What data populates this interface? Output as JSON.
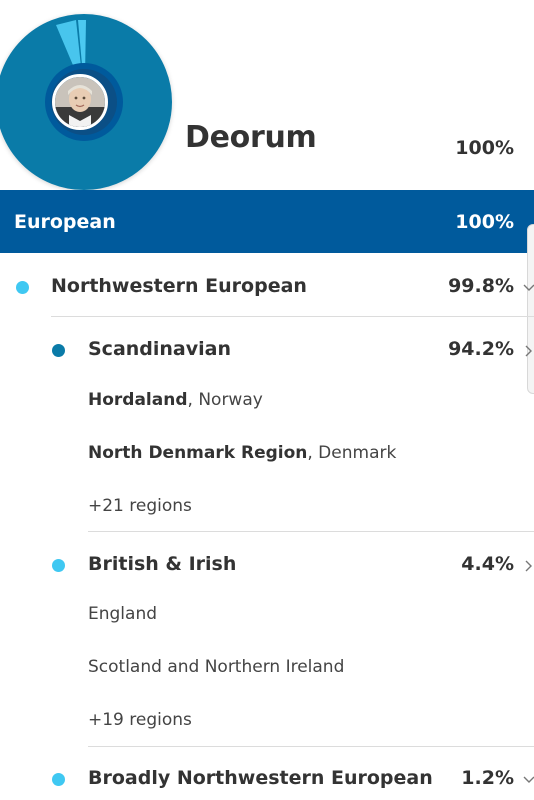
{
  "profile": {
    "name": "Deorum",
    "total_percent": "100%",
    "avatar_icon": "profile-photo"
  },
  "colors": {
    "brand_blue": "#005a9c",
    "donut_main": "#0a7ba8",
    "donut_light": "#4cc9f0",
    "dot_light": "#3fc8f2",
    "dot_dark": "#0a7ba8"
  },
  "region": {
    "label": "European",
    "percent": "100%"
  },
  "groups": [
    {
      "label": "Northwestern European",
      "percent": "99.8%",
      "dot_color": "#3fc8f2",
      "chevron_icon": "chevron-down-icon"
    }
  ],
  "subgroups": [
    {
      "label": "Scandinavian",
      "percent": "94.2%",
      "dot_color": "#0a7ba8",
      "chevron_icon": "chevron-right-icon",
      "items": [
        {
          "primary": "Hordaland",
          "secondary": ", Norway"
        },
        {
          "primary": "North Denmark Region",
          "secondary": ", Denmark"
        },
        {
          "primary": "",
          "secondary": "+21 regions"
        }
      ]
    },
    {
      "label": "British & Irish",
      "percent": "4.4%",
      "dot_color": "#3fc8f2",
      "chevron_icon": "chevron-right-icon",
      "items": [
        {
          "primary": "",
          "secondary": "England"
        },
        {
          "primary": "",
          "secondary": "Scotland and Northern Ireland"
        },
        {
          "primary": "",
          "secondary": "+19 regions"
        }
      ]
    },
    {
      "label": "Broadly Northwestern European",
      "percent": "1.2%",
      "dot_color": "#3fc8f2",
      "chevron_icon": "chevron-down-icon"
    }
  ]
}
